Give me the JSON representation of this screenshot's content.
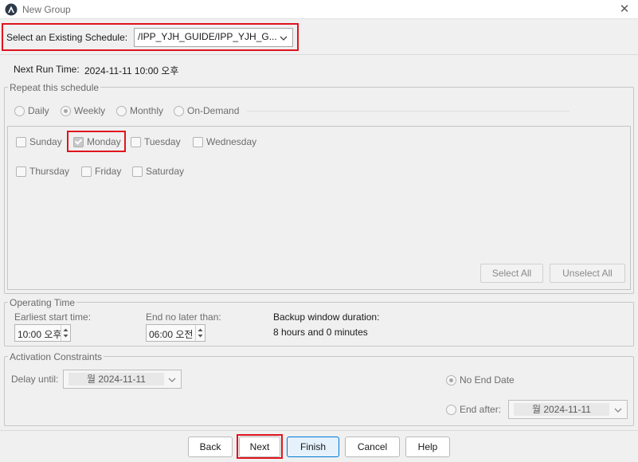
{
  "window": {
    "title": "New Group",
    "close_glyph": "✕"
  },
  "schedule": {
    "label": "Select an Existing Schedule:",
    "value": "/IPP_YJH_GUIDE/IPP_YJH_G..."
  },
  "next_run": {
    "label": "Next Run Time:",
    "value": "2024-11-11 10:00 오후"
  },
  "repeat": {
    "legend": "Repeat this schedule",
    "options": [
      "Daily",
      "Weekly",
      "Monthly",
      "On-Demand"
    ],
    "selected": "Weekly"
  },
  "days": {
    "row1": [
      "Sunday",
      "Monday",
      "Tuesday",
      "Wednesday"
    ],
    "row2": [
      "Thursday",
      "Friday",
      "Saturday"
    ],
    "checked": [
      "Monday"
    ],
    "select_all": "Select All",
    "unselect_all": "Unselect All"
  },
  "operating": {
    "legend": "Operating Time",
    "start_label": "Earliest start time:",
    "start_value": "10:00 오후",
    "end_label": "End no later than:",
    "end_value": "06:00 오전",
    "duration_label": "Backup window duration:",
    "duration_value": "8 hours and 0 minutes"
  },
  "activation": {
    "legend": "Activation Constraints",
    "delay_label": "Delay until:",
    "delay_value": "월 2024-11-11",
    "no_end_label": "No End Date",
    "end_after_label": "End after:",
    "end_after_value": "월 2024-11-11"
  },
  "buttons": {
    "back": "Back",
    "next": "Next",
    "finish": "Finish",
    "cancel": "Cancel",
    "help": "Help"
  },
  "colors": {
    "highlight": "#e0141e",
    "default_button_border": "#0078d7",
    "default_button_bg": "#e5f1fb"
  }
}
